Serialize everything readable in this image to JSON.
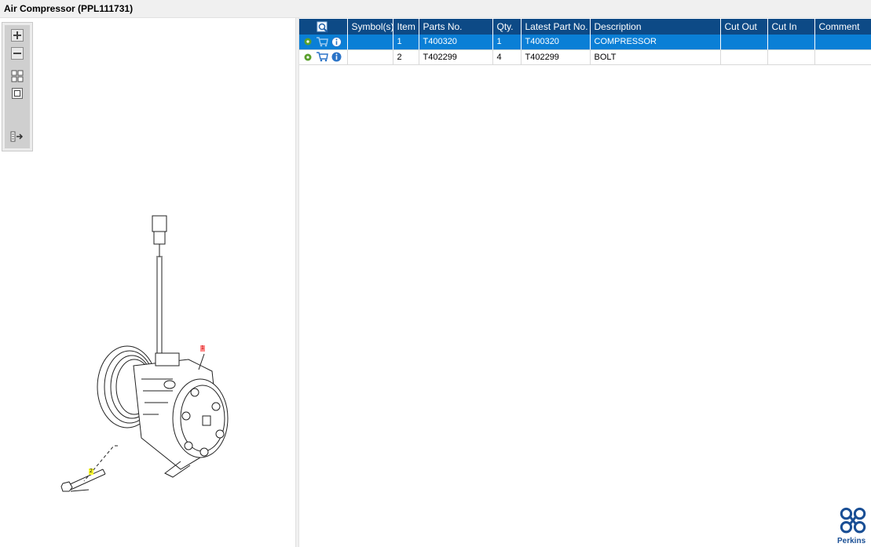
{
  "window": {
    "title": "Air Compressor (PPL111731)"
  },
  "toolbar": {
    "buttons": [
      {
        "icon": "zoom-in-icon"
      },
      {
        "icon": "zoom-out-icon"
      },
      {
        "icon": "fit-grid-icon"
      },
      {
        "icon": "actual-size-icon"
      },
      {
        "icon": "panel-toggle-icon"
      }
    ]
  },
  "drawing": {
    "callouts": [
      "1",
      "2"
    ]
  },
  "parts_table": {
    "columns": {
      "lookup": "",
      "symbols": "Symbol(s)",
      "item": "Item",
      "parts_no": "Parts No.",
      "qty": "Qty.",
      "latest_part_no": "Latest Part No.",
      "description": "Description",
      "cut_out": "Cut Out",
      "cut_in": "Cut In",
      "comment": "Comment"
    },
    "rows": [
      {
        "symbols": "",
        "item": "1",
        "parts_no": "T400320",
        "qty": "1",
        "latest_part_no": "T400320",
        "description": "COMPRESSOR",
        "cut_out": "",
        "cut_in": "",
        "comment": "",
        "selected": true
      },
      {
        "symbols": "",
        "item": "2",
        "parts_no": "T402299",
        "qty": "4",
        "latest_part_no": "T402299",
        "description": "BOLT",
        "cut_out": "",
        "cut_in": "",
        "comment": "",
        "selected": false
      }
    ]
  },
  "brand": {
    "name": "Perkins",
    "color": "#1a4f95"
  },
  "colors": {
    "header": "#0d4a86",
    "selected_row": "#0a7fd6",
    "gear": "#5aa02c",
    "info": "#2b74c7"
  }
}
